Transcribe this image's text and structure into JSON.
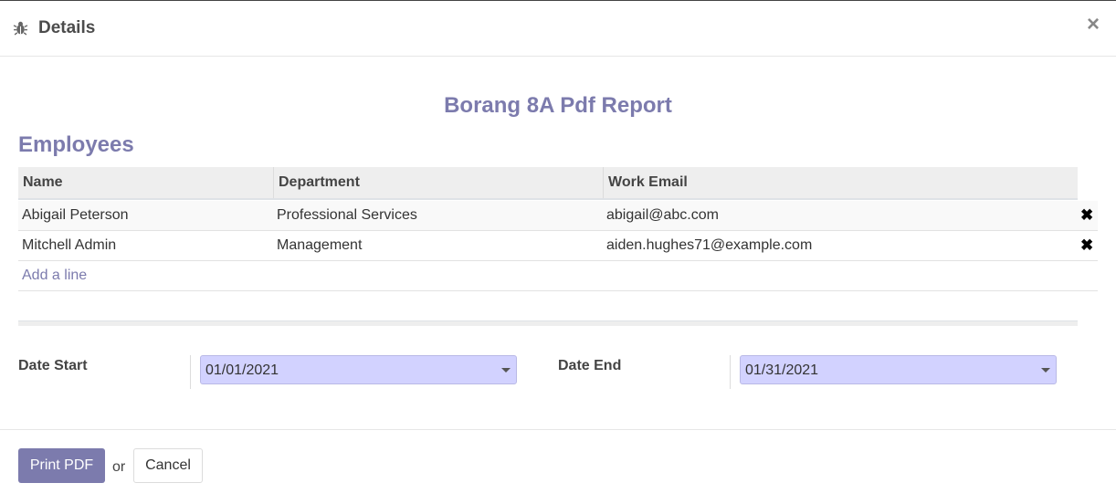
{
  "dialog": {
    "title": "Details",
    "icon": "bug-icon",
    "close_glyph": "×"
  },
  "report": {
    "title": "Borang 8A Pdf Report",
    "section_title": "Employees"
  },
  "table": {
    "headers": [
      "Name",
      "Department",
      "Work Email"
    ],
    "rows": [
      {
        "name": "Abigail Peterson",
        "department": "Professional Services",
        "email": "abigail@abc.com"
      },
      {
        "name": "Mitchell Admin",
        "department": "Management",
        "email": "aiden.hughes71@example.com"
      }
    ],
    "add_line": "Add a line",
    "delete_glyph": "✖"
  },
  "dates": {
    "start_label": "Date Start",
    "start_value": "01/01/2021",
    "end_label": "Date End",
    "end_value": "01/31/2021"
  },
  "footer": {
    "print_label": "Print PDF",
    "or_text": "or",
    "cancel_label": "Cancel"
  },
  "colors": {
    "accent": "#7c7bad",
    "field_bg": "#d2d2ff"
  }
}
